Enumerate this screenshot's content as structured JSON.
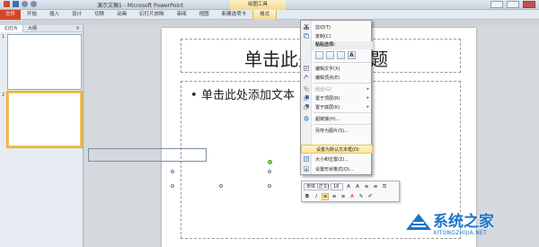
{
  "titlebar": {
    "title": "演示文稿1 - Microsoft PowerPoint",
    "context_tab_group": "绘图工具"
  },
  "ribbon": {
    "tabs": [
      "文件",
      "开始",
      "插入",
      "设计",
      "切换",
      "动画",
      "幻灯片放映",
      "审阅",
      "视图",
      "新建选项卡",
      "格式"
    ],
    "active_tab": "格式"
  },
  "left_pane": {
    "tabs": [
      "幻灯片",
      "大纲"
    ],
    "close": "×",
    "slides": [
      {
        "number": "1"
      },
      {
        "number": "2",
        "selected": true
      }
    ]
  },
  "slide": {
    "title_placeholder": "单击此处添加标题",
    "body_bullet": "•",
    "body_placeholder": "单击此处添加文本"
  },
  "context_menu": {
    "items": [
      {
        "label": "剪切(T)",
        "icon": "scissors-icon"
      },
      {
        "label": "复制(C)",
        "icon": "copy-icon"
      }
    ],
    "paste_section": "粘贴选项:",
    "paste_options": [
      "",
      "",
      "",
      "A"
    ],
    "items2": [
      {
        "label": "编辑文字(X)",
        "icon": "edit-text-icon"
      },
      {
        "label": "编辑顶点(E)",
        "icon": "edit-points-icon"
      },
      {
        "label": "组合(G)",
        "icon": "group-icon",
        "disabled": true,
        "submenu": true
      },
      {
        "label": "置于顶层(R)",
        "icon": "bring-front-icon",
        "submenu": true
      },
      {
        "label": "置于底层(K)",
        "icon": "send-back-icon",
        "submenu": true
      },
      {
        "label": "超链接(H)...",
        "icon": "hyperlink-icon"
      },
      {
        "label": "另存为图片(S)...",
        "icon": "save-picture-icon"
      },
      {
        "label": "设置为默认文本框(D)",
        "icon": "default-textbox-icon",
        "highlighted": true
      },
      {
        "label": "大小和位置(Z)...",
        "icon": "size-position-icon"
      },
      {
        "label": "设置形状格式(O)...",
        "icon": "format-shape-icon"
      }
    ],
    "submenu_arrow": "▸"
  },
  "mini_toolbar": {
    "font": "宋体 (正文)",
    "size": "18",
    "row1_buttons": [
      "A",
      "A",
      "≡",
      "≡",
      "☰"
    ],
    "row2_buttons": [
      "B",
      "I",
      "≡",
      "≡",
      "≡",
      "A",
      "✎",
      "✐"
    ]
  },
  "watermark": {
    "text": "系统之家",
    "sub": "XITONGZHIJIA.NET"
  }
}
